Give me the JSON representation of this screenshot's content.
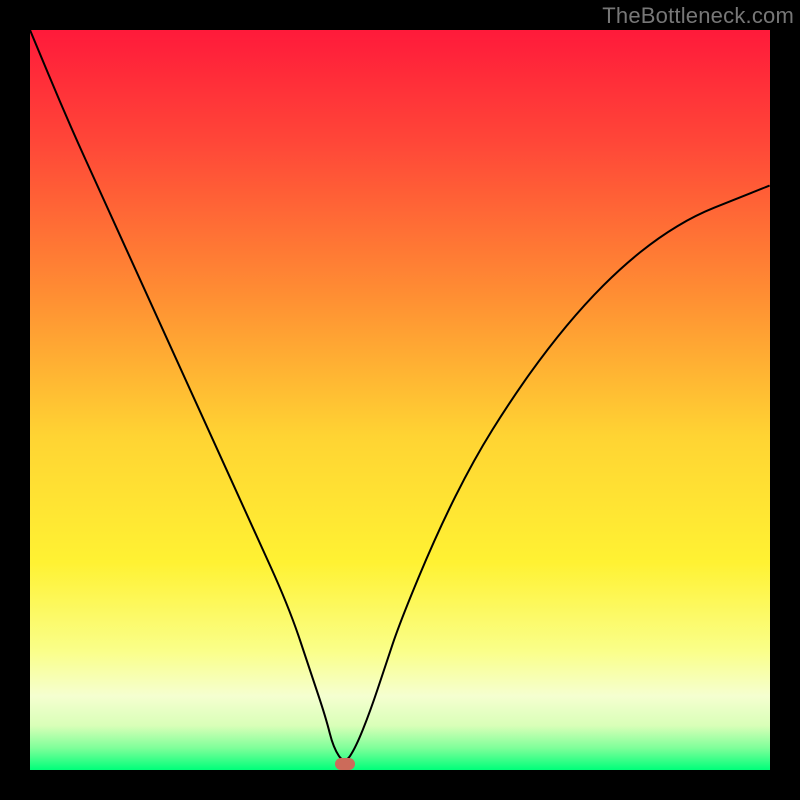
{
  "watermark": "TheBottleneck.com",
  "gradient": {
    "stops": [
      {
        "pct": 0,
        "color": "#ff1a3a"
      },
      {
        "pct": 15,
        "color": "#ff4638"
      },
      {
        "pct": 35,
        "color": "#ff8b33"
      },
      {
        "pct": 55,
        "color": "#ffd433"
      },
      {
        "pct": 72,
        "color": "#fff233"
      },
      {
        "pct": 84,
        "color": "#faff8a"
      },
      {
        "pct": 90,
        "color": "#f5ffd0"
      },
      {
        "pct": 94,
        "color": "#d9ffb8"
      },
      {
        "pct": 97,
        "color": "#80ff9a"
      },
      {
        "pct": 100,
        "color": "#00ff7a"
      }
    ]
  },
  "marker": {
    "x_pct": 42.5,
    "y_pct": 99.2,
    "color": "#cc6b5a"
  },
  "curve": {
    "stroke": "#000000",
    "width": 2
  },
  "chart_data": {
    "type": "line",
    "title": "",
    "xlabel": "",
    "ylabel": "",
    "xlim": [
      0,
      100
    ],
    "ylim": [
      0,
      100
    ],
    "series": [
      {
        "name": "curve",
        "x": [
          0,
          5,
          10,
          15,
          20,
          25,
          30,
          35,
          38,
          40,
          41,
          42.5,
          44,
          46,
          48,
          50,
          55,
          60,
          65,
          70,
          75,
          80,
          85,
          90,
          95,
          100
        ],
        "y": [
          100,
          88,
          77,
          66,
          55,
          44,
          33,
          22,
          13,
          7,
          3,
          0.8,
          3,
          8,
          14,
          20,
          32,
          42,
          50,
          57,
          63,
          68,
          72,
          75,
          77,
          79
        ]
      }
    ],
    "annotations": [
      {
        "type": "marker",
        "x": 42.5,
        "y": 0.8,
        "label": "bottleneck-minimum"
      }
    ]
  }
}
